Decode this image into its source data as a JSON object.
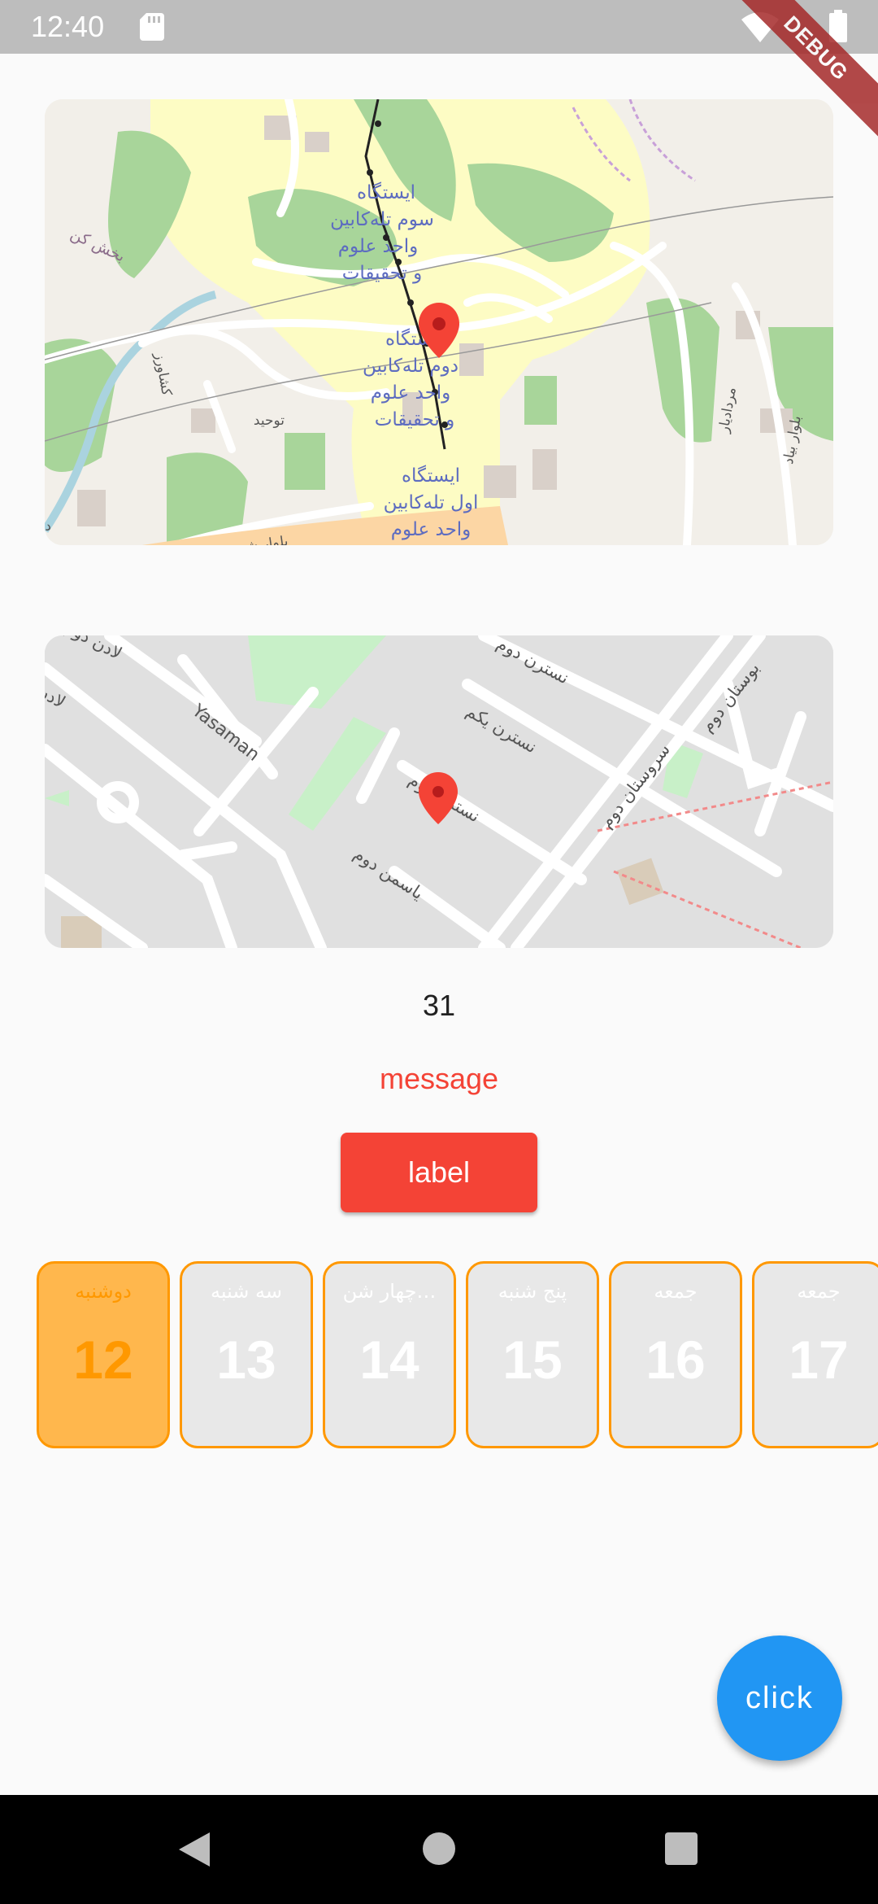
{
  "status_bar": {
    "time": "12:40",
    "debug_label": "DEBUG"
  },
  "map1": {
    "labels": {
      "l1": "ایستگاه",
      "l2": "سوم تله‌کابین",
      "l3": "واحد علوم",
      "l4": "و تحقیقات",
      "l5": "ایستگاه",
      "l6": "دوم تله‌کابین",
      "l7": "واحد علوم",
      "l8": "و تحقیقات",
      "l9": "ایستگاه",
      "l10": "اول تله‌کابین",
      "l11": "واحد علوم",
      "side1": "بخش کن",
      "side2": "کشاورز",
      "side3": "توحید",
      "side4": "بلوار شهید",
      "side5": "مردادیار",
      "side6": "بلوار بیاد",
      "side7": "دز"
    }
  },
  "map2": {
    "labels": {
      "s1": "نسترن دوم",
      "s2": "لادن دوم",
      "s3": "لادن یک",
      "s4": "Yasaman",
      "s5": "نسترن یکم",
      "s6": "بوستان دوم",
      "s7": "سروستان دوم",
      "s8": "نسترن دوم",
      "s9": "یاسمن دوم"
    }
  },
  "counter": "31",
  "message": "message",
  "button_label": "label",
  "days": [
    {
      "name": "دوشنبه",
      "number": "12",
      "selected": true
    },
    {
      "name": "سه شنبه",
      "number": "13",
      "selected": false
    },
    {
      "name": "…چهار شن",
      "number": "14",
      "selected": false
    },
    {
      "name": "پنج شنبه",
      "number": "15",
      "selected": false
    },
    {
      "name": "جمعه",
      "number": "16",
      "selected": false
    },
    {
      "name": "جمعه",
      "number": "17",
      "selected": false
    }
  ],
  "fab_label": "click",
  "colors": {
    "accent_red": "#f44336",
    "selected_day": "#ffb74d",
    "day_border": "#ff9800",
    "fab_blue": "#2196f3"
  }
}
